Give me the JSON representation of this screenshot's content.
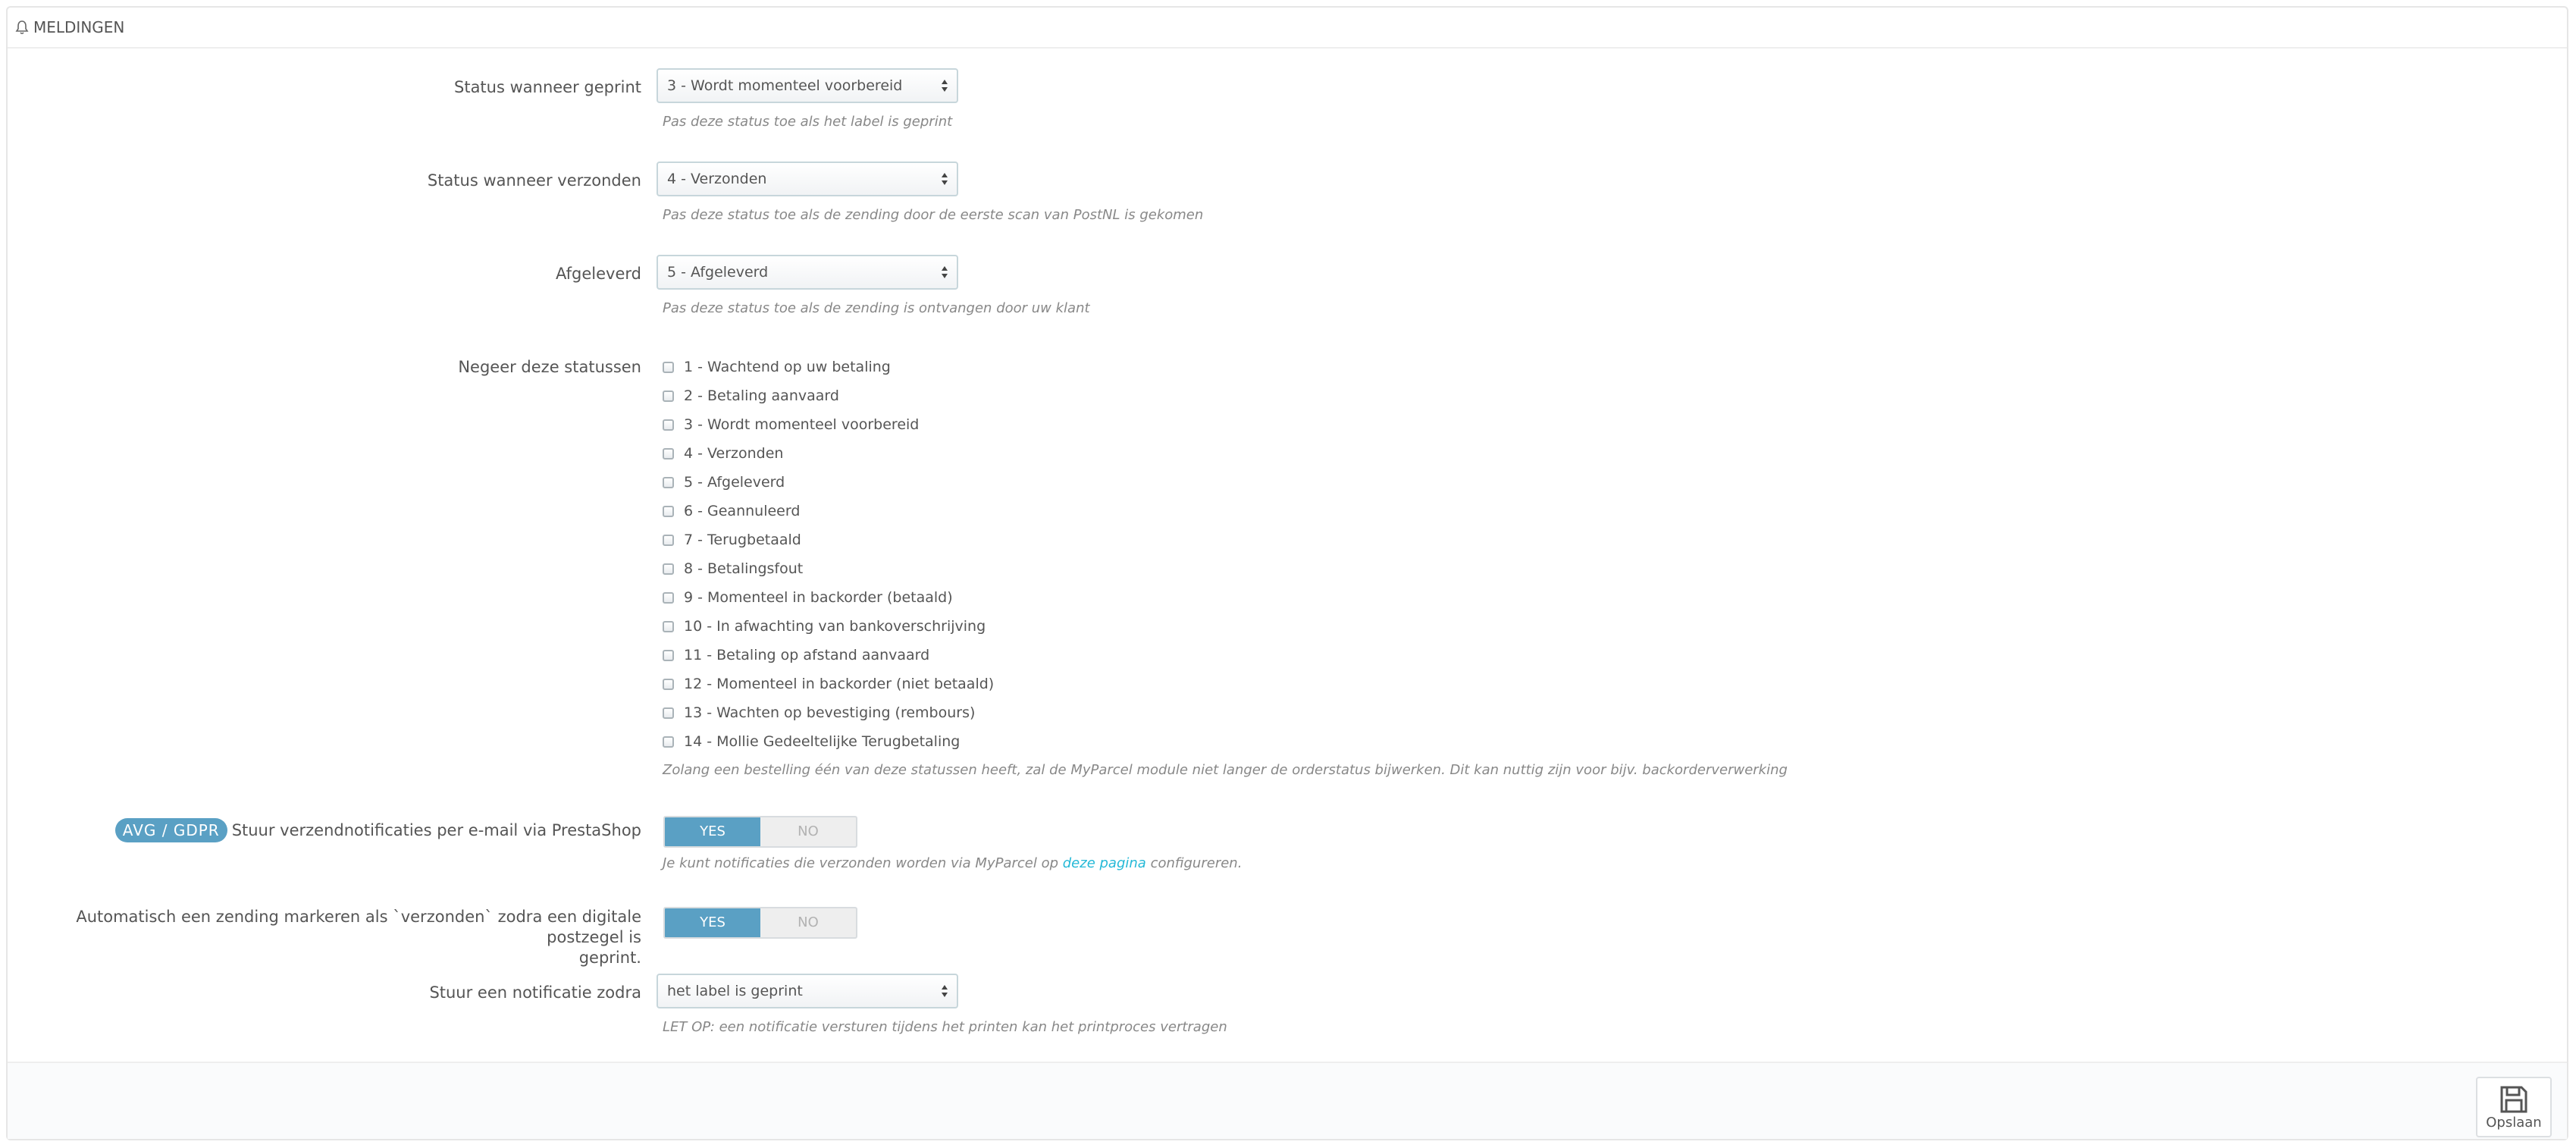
{
  "panel": {
    "title": "MELDINGEN"
  },
  "status_printed": {
    "label": "Status wanneer geprint",
    "value": "3 - Wordt momenteel voorbereid",
    "help": "Pas deze status toe als het label is geprint"
  },
  "status_shipped": {
    "label": "Status wanneer verzonden",
    "value": "4 - Verzonden",
    "help": "Pas deze status toe als de zending door de eerste scan van PostNL is gekomen"
  },
  "status_delivered": {
    "label": "Afgeleverd",
    "value": "5 - Afgeleverd",
    "help": "Pas deze status toe als de zending is ontvangen door uw klant"
  },
  "ignore_statuses": {
    "label": "Negeer deze statussen",
    "options": [
      "1 - Wachtend op uw betaling",
      "2 - Betaling aanvaard",
      "3 - Wordt momenteel voorbereid",
      "4 - Verzonden",
      "5 - Afgeleverd",
      "6 - Geannuleerd",
      "7 - Terugbetaald",
      "8 - Betalingsfout",
      "9 - Momenteel in backorder (betaald)",
      "10 - In afwachting van bankoverschrijving",
      "11 - Betaling op afstand aanvaard",
      "12 - Momenteel in backorder (niet betaald)",
      "13 - Wachten op bevestiging (rembours)",
      "14 - Mollie Gedeeltelijke Terugbetaling"
    ],
    "help": "Zolang een bestelling één van deze statussen heeft, zal de MyParcel module niet langer de orderstatus bijwerken. Dit kan nuttig zijn voor bijv. backorderverwerking"
  },
  "email_notifications": {
    "badge": "AVG / GDPR",
    "label": "Stuur verzendnotificaties per e-mail via PrestaShop",
    "yes": "YES",
    "no": "NO",
    "help_before": "Je kunt notificaties die verzonden worden via MyParcel op",
    "help_link": "deze pagina",
    "help_after": "configureren."
  },
  "auto_mark": {
    "label_line1": "Automatisch een zending markeren als `verzonden` zodra een digitale postzegel is",
    "label_line2": "geprint.",
    "yes": "YES",
    "no": "NO"
  },
  "notify_when": {
    "label": "Stuur een notificatie zodra",
    "value": "het label is geprint",
    "help": "LET OP: een notificatie versturen tijdens het printen kan het printproces vertragen"
  },
  "footer": {
    "save_label": "Opslaan"
  }
}
